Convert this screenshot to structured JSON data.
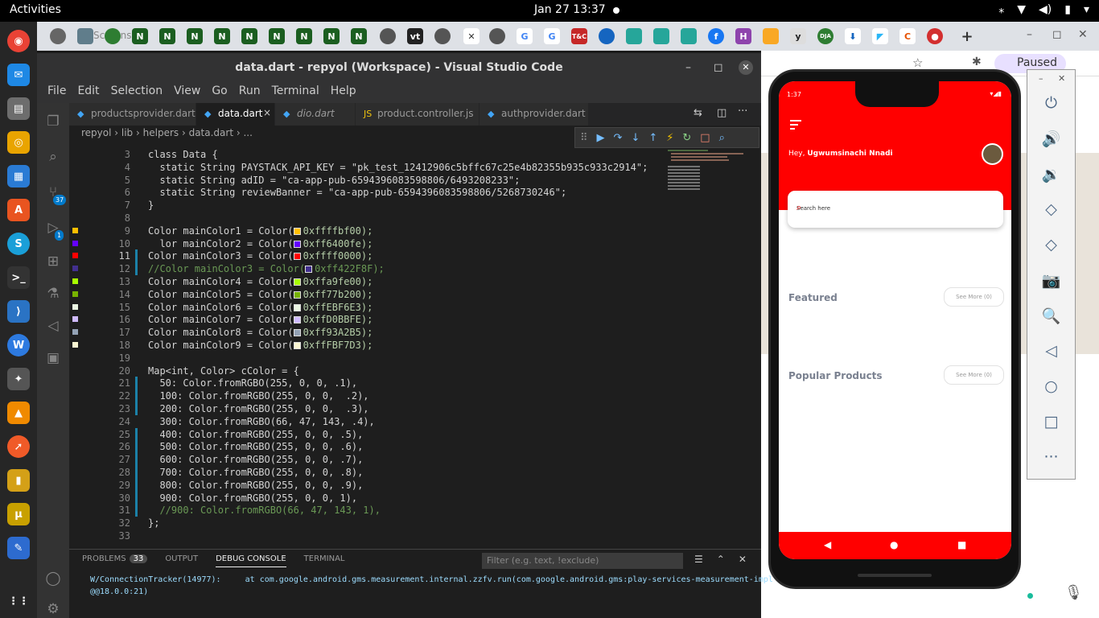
{
  "topbar": {
    "activities": "Activities",
    "clock": "Jan 27  13:37",
    "tray": [
      "⁎",
      "▼",
      "◀)",
      "▮",
      "▾"
    ]
  },
  "chrome": {
    "tab_title": "Screenshot",
    "paused": "Paused",
    "new_tab": "+"
  },
  "vscode": {
    "title": "data.dart - repyol (Workspace) - Visual Studio Code",
    "menu": [
      "File",
      "Edit",
      "Selection",
      "View",
      "Go",
      "Run",
      "Terminal",
      "Help"
    ],
    "tabs": [
      {
        "label": "productsprovider.dart",
        "active": false
      },
      {
        "label": "data.dart",
        "active": true
      },
      {
        "label": "dio.dart",
        "active": false
      },
      {
        "label": "product.controller.js",
        "active": false
      },
      {
        "label": "authprovider.dart",
        "active": false
      }
    ],
    "close": "×",
    "breadcrumb": [
      "repyol",
      "lib",
      "helpers",
      "data.dart",
      "..."
    ],
    "scm_badge": "37",
    "ext_badge": "1",
    "code": [
      {
        "n": "3",
        "t": "class Data {"
      },
      {
        "n": "4",
        "t": "  static String PAYSTACK_API_KEY = \"pk_test_12412906c5bffc67c25e4b82355b935c933c2914\";"
      },
      {
        "n": "5",
        "t": "  static String adID = \"ca-app-pub-6594396083598806/6493208233\";"
      },
      {
        "n": "6",
        "t": "  static String reviewBanner = \"ca-app-pub-6594396083598806/5268730246\";"
      },
      {
        "n": "7",
        "t": "}"
      },
      {
        "n": "8",
        "t": ""
      },
      {
        "n": "9",
        "t": "Color mainColor1 = Color(",
        "c": "#ffbf00",
        "v": "0xffffbf00);"
      },
      {
        "n": "10",
        "t": "  lor mainColor2 = Color(",
        "c": "#6400fe",
        "v": "0xff6400fe);"
      },
      {
        "n": "11",
        "t": "Color mainColor3 = Color(",
        "c": "#ff0000",
        "v": "0xffff0000);"
      },
      {
        "n": "12",
        "t": "//Color mainColor3 = Color(",
        "c": "#422F8F",
        "v": "0xff422F8F);",
        "comment": true
      },
      {
        "n": "13",
        "t": "Color mainColor4 = Color(",
        "c": "#a9fe00",
        "v": "0xffa9fe00);"
      },
      {
        "n": "14",
        "t": "Color mainColor5 = Color(",
        "c": "#77b200",
        "v": "0xff77b200);"
      },
      {
        "n": "15",
        "t": "Color mainColor6 = Color(",
        "c": "#EBF6E3",
        "v": "0xffEBF6E3);"
      },
      {
        "n": "16",
        "t": "Color mainColor7 = Color(",
        "c": "#D0BBFE",
        "v": "0xffD0BBFE);"
      },
      {
        "n": "17",
        "t": "Color mainColor8 = Color(",
        "c": "#93A2B5",
        "v": "0xff93A2B5);"
      },
      {
        "n": "18",
        "t": "Color mainColor9 = Color(",
        "c": "#FBF7D3",
        "v": "0xffFBF7D3);"
      },
      {
        "n": "19",
        "t": ""
      },
      {
        "n": "20",
        "t": "Map<int, Color> cColor = {"
      },
      {
        "n": "21",
        "t": "  50: Color.fromRGBO(255, 0, 0, .1),"
      },
      {
        "n": "22",
        "t": "  100: Color.fromRGBO(255, 0, 0,  .2),"
      },
      {
        "n": "23",
        "t": "  200: Color.fromRGBO(255, 0, 0,  .3),"
      },
      {
        "n": "24",
        "t": "  300: Color.fromRGBO(66, 47, 143, .4),"
      },
      {
        "n": "25",
        "t": "  400: Color.fromRGBO(255, 0, 0, .5),"
      },
      {
        "n": "26",
        "t": "  500: Color.fromRGBO(255, 0, 0, .6),"
      },
      {
        "n": "27",
        "t": "  600: Color.fromRGBO(255, 0, 0, .7),"
      },
      {
        "n": "28",
        "t": "  700: Color.fromRGBO(255, 0, 0, .8),"
      },
      {
        "n": "29",
        "t": "  800: Color.fromRGBO(255, 0, 0, .9),"
      },
      {
        "n": "30",
        "t": "  900: Color.fromRGBO(255, 0, 0, 1),"
      },
      {
        "n": "31",
        "t": "  //900: Color.fromRGBO(66, 47, 143, 1),",
        "comment": true
      },
      {
        "n": "32",
        "t": "};"
      },
      {
        "n": "33",
        "t": ""
      }
    ],
    "panel": {
      "tabs": [
        "PROBLEMS",
        "OUTPUT",
        "DEBUG CONSOLE",
        "TERMINAL"
      ],
      "problems_count": "33",
      "filter_placeholder": "Filter (e.g. text, !exclude)",
      "output": "W/ConnectionTracker(14977):     at com.google.android.gms.measurement.internal.zzfv.run(com.google.android.gms:play-services-measurement-impl\n@@18.0.0:21)"
    }
  },
  "phone": {
    "time": "1:37",
    "greeting_prefix": "Hey, ",
    "user_name": "Ugwumsinachi Nnadi",
    "search_placeholder": "Search here",
    "featured": "Featured",
    "popular": "Popular Products",
    "see_more": "See More (0)",
    "nav": [
      "◀",
      "●",
      "■"
    ],
    "accent": "#ff0000"
  },
  "emulator": {
    "minimize": "–",
    "close": "✕",
    "controls": [
      "⏻",
      "🔊",
      "🔉",
      "◇",
      "◇",
      "📷",
      "🔍",
      "◁",
      "○",
      "□",
      "···"
    ]
  }
}
